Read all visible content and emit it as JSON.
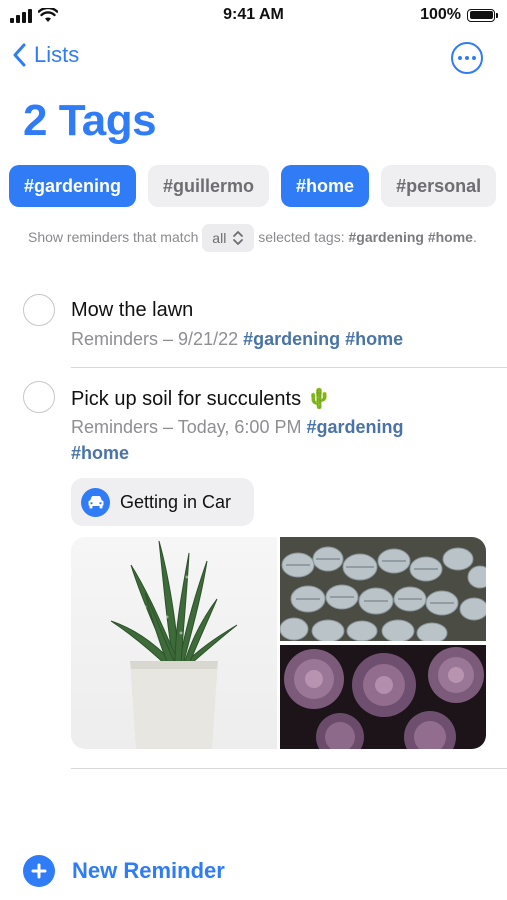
{
  "status_bar": {
    "time": "9:41 AM",
    "battery": "100%"
  },
  "nav": {
    "back_label": "Lists"
  },
  "title": "2 Tags",
  "tags": [
    {
      "label": "#gardening",
      "selected": true
    },
    {
      "label": "#guillermo",
      "selected": false
    },
    {
      "label": "#home",
      "selected": true
    },
    {
      "label": "#personal",
      "selected": false
    }
  ],
  "filter": {
    "prefix": "Show reminders that match",
    "match_value": "all",
    "middle": "selected tags:",
    "tag1": "#gardening",
    "tag2": "#home",
    "suffix": "."
  },
  "reminders": [
    {
      "title": "Mow the lawn",
      "meta": "Reminders – 9/21/22",
      "tags": [
        "#gardening",
        "#home"
      ]
    },
    {
      "title": "Pick up soil for succulents 🌵",
      "meta": "Reminders – Today, 6:00 PM",
      "tags": [
        "#gardening",
        "#home"
      ],
      "location": "Getting in Car"
    }
  ],
  "new_reminder_label": "New Reminder",
  "colors": {
    "accent": "#2f7cf6",
    "tag_text": "#4a74a8",
    "chip_off_bg": "#efeff1"
  },
  "icons": [
    "cellular-signal-icon",
    "wifi-icon",
    "battery-icon",
    "chevron-left-icon",
    "ellipsis-circle-icon",
    "chevron-up-down-icon",
    "car-icon",
    "plus-circle-icon"
  ]
}
